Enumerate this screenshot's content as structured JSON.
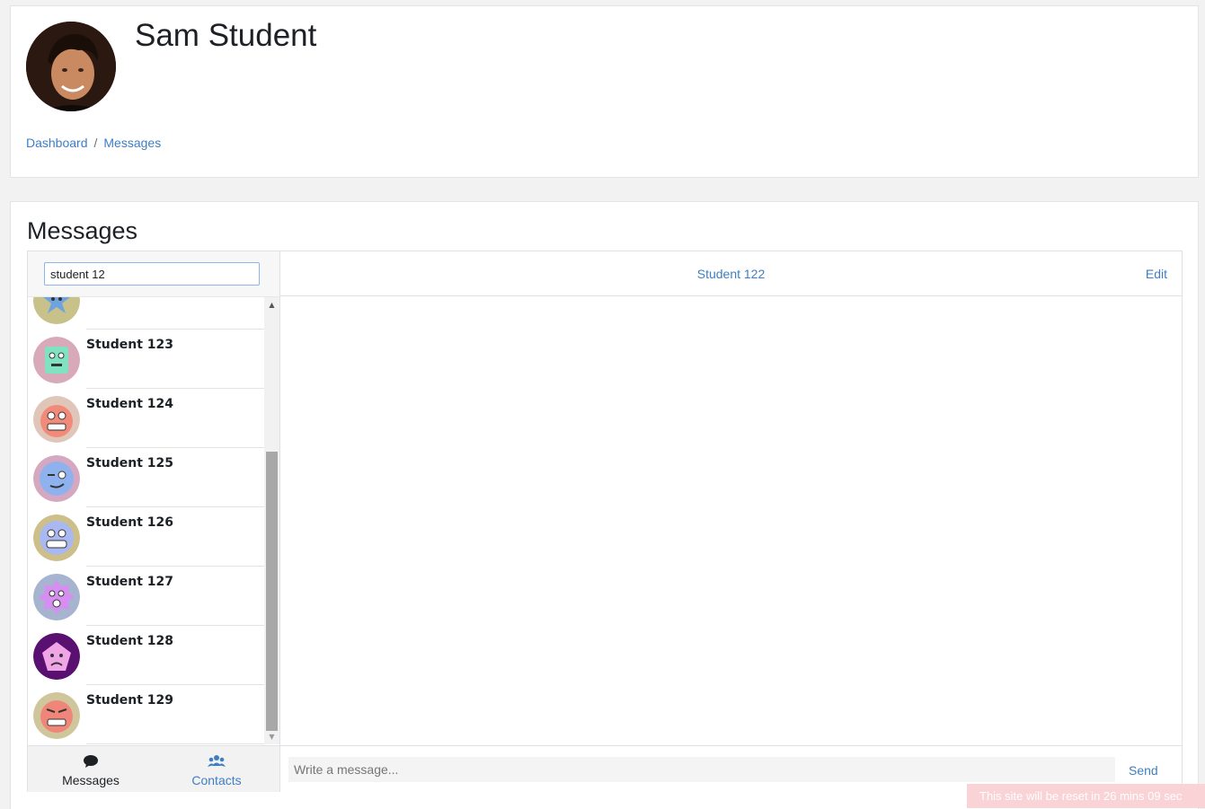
{
  "user": {
    "name": "Sam Student"
  },
  "breadcrumb": {
    "items": [
      "Dashboard",
      "Messages"
    ],
    "separator": "/"
  },
  "page": {
    "title": "Messages"
  },
  "search": {
    "value": "student 12"
  },
  "contacts": [
    {
      "name": "",
      "icon": "blue-star-face-icon"
    },
    {
      "name": "Student 123",
      "icon": "green-square-face-icon"
    },
    {
      "name": "Student 124",
      "icon": "red-grin-glasses-icon"
    },
    {
      "name": "Student 125",
      "icon": "blue-wink-face-icon"
    },
    {
      "name": "Student 126",
      "icon": "blue-grin-face-icon"
    },
    {
      "name": "Student 127",
      "icon": "purple-gear-face-icon"
    },
    {
      "name": "Student 128",
      "icon": "pink-pentagon-face-icon"
    },
    {
      "name": "Student 129",
      "icon": "red-grimace-face-icon"
    }
  ],
  "footer_tabs": {
    "messages": "Messages",
    "contacts": "Contacts"
  },
  "conversation": {
    "title": "Student 122",
    "edit_label": "Edit",
    "composer_placeholder": "Write a message...",
    "send_label": "Send"
  },
  "banner": {
    "text": "This site will be reset in 26 mins 09 sec"
  },
  "colors": {
    "link": "#3f7ec2",
    "banner": "#f9d3d6"
  }
}
